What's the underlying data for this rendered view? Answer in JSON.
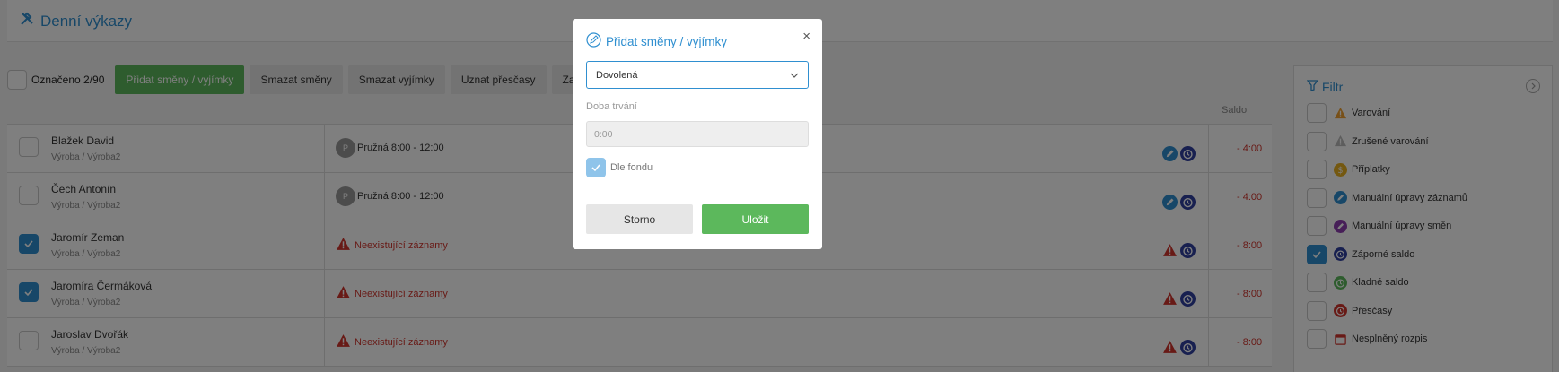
{
  "header": {
    "title": "Denní výkazy",
    "icon": "tools-icon"
  },
  "toolbar": {
    "marked": "Označeno 2/90",
    "buttons": [
      "Přidat směny / vyjímky",
      "Smazat směny",
      "Smazat vyjímky",
      "Uznat přesčasy",
      "Zarovnat"
    ]
  },
  "table": {
    "saldo_header": "Saldo",
    "rows": [
      {
        "checked": false,
        "name": "Blažek David",
        "dept": "Výroba / Výroba2",
        "type": "shift",
        "badge": "P",
        "shift": "Pružná 8:00 - 12:00",
        "icons": [
          "pencil-icon",
          "alarm-clock-icon"
        ],
        "saldo": "- 4:00"
      },
      {
        "checked": false,
        "name": "Čech Antonín",
        "dept": "Výroba / Výroba2",
        "type": "shift",
        "badge": "P",
        "shift": "Pružná 8:00 - 12:00",
        "icons": [
          "pencil-icon",
          "alarm-clock-icon"
        ],
        "saldo": "- 4:00"
      },
      {
        "checked": true,
        "name": "Jaromír Zeman",
        "dept": "Výroba / Výroba2",
        "type": "warning",
        "warning": "Neexistující záznamy",
        "icons": [
          "warning-icon",
          "alarm-clock-icon"
        ],
        "saldo": "- 8:00"
      },
      {
        "checked": true,
        "name": "Jaromíra Čermáková",
        "dept": "Výroba / Výroba2",
        "type": "warning",
        "warning": "Neexistující záznamy",
        "icons": [
          "warning-icon",
          "alarm-clock-icon"
        ],
        "saldo": "- 8:00"
      },
      {
        "checked": false,
        "name": "Jaroslav Dvořák",
        "dept": "Výroba / Výroba2",
        "type": "warning",
        "warning": "Neexistující záznamy",
        "icons": [
          "warning-icon",
          "alarm-clock-icon"
        ],
        "saldo": "- 8:00"
      }
    ]
  },
  "filter": {
    "title": "Filtr",
    "items": [
      {
        "label": "Varování",
        "checked": false,
        "icon": "warning-icon",
        "color": "#f0a030"
      },
      {
        "label": "Zrušené varování",
        "checked": false,
        "icon": "warning-gray-icon",
        "color": "#bbbbbb"
      },
      {
        "label": "Příplatky",
        "checked": false,
        "icon": "dollar-icon",
        "color": "#e8b020"
      },
      {
        "label": "Manuální úpravy záznamů",
        "checked": false,
        "icon": "pencil-icon",
        "color": "#2f8fd0"
      },
      {
        "label": "Manuální úpravy směn",
        "checked": false,
        "icon": "pencil-icon",
        "color": "#8e3fb0"
      },
      {
        "label": "Záporné saldo",
        "checked": true,
        "icon": "alarm-clock-icon",
        "color": "#3040a0"
      },
      {
        "label": "Kladné saldo",
        "checked": false,
        "icon": "alarm-clock-icon",
        "color": "#5cb85c"
      },
      {
        "label": "Přesčasy",
        "checked": false,
        "icon": "alarm-clock-icon",
        "color": "#d0342c"
      },
      {
        "label": "Nesplněný rozpis",
        "checked": false,
        "icon": "calendar-icon",
        "color": "#d0342c"
      }
    ]
  },
  "modal": {
    "title": "Přidat směny / vyjímky",
    "close": "×",
    "select_value": "Dovolená",
    "duration_label": "Doba trvání",
    "duration_placeholder": "0:00",
    "checkbox_label": "Dle fondu",
    "cancel": "Storno",
    "save": "Uložit"
  },
  "colors": {
    "accent": "#2f8fd0",
    "success": "#5cb85c",
    "danger": "#d0342c"
  }
}
